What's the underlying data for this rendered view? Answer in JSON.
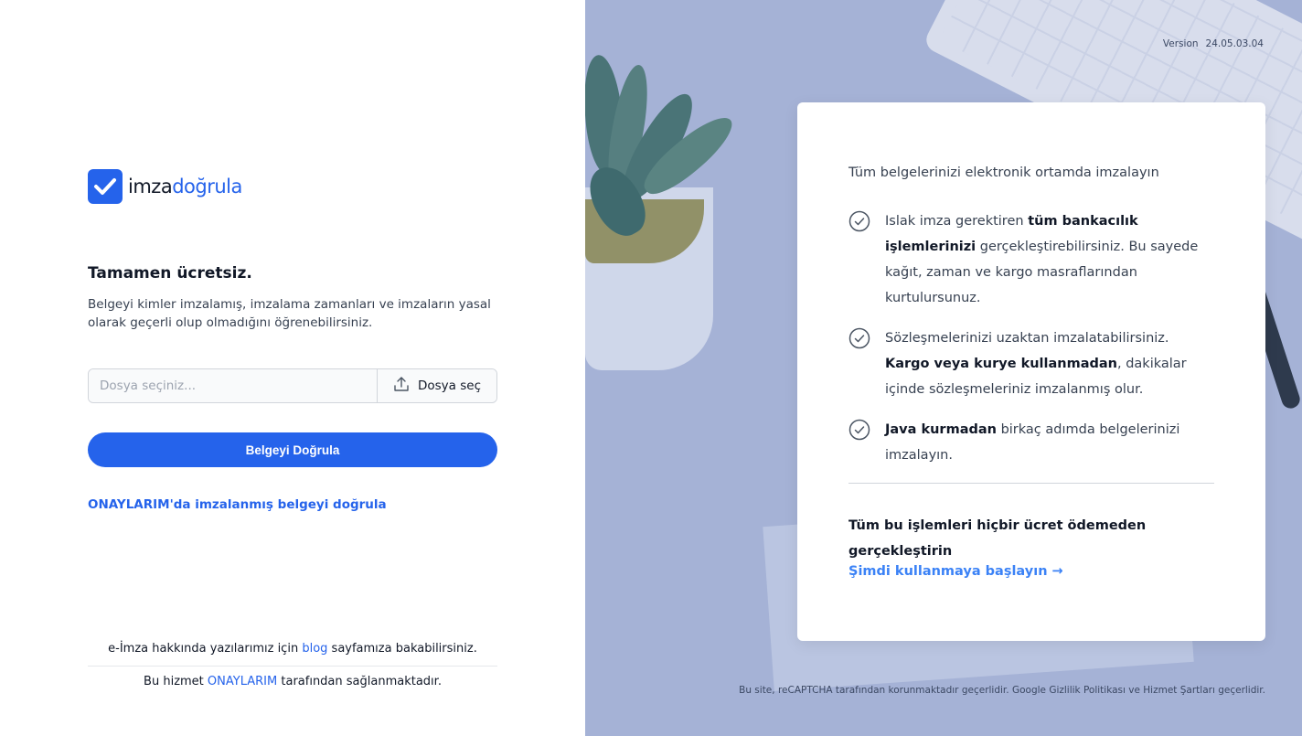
{
  "brand": {
    "name_part1": "imza",
    "name_part2": "doğrula",
    "accent": "#2563eb"
  },
  "left": {
    "title": "Tamamen ücretsiz.",
    "description": "Belgeyi kimler imzalamış, imzalama zamanları ve imzaların yasal olarak geçerli olup olmadığını öğrenebilirsiniz.",
    "file_placeholder": "Dosya seçiniz...",
    "file_button": "Dosya seç",
    "verify_button": "Belgeyi Doğrula",
    "onay_link": "ONAYLARIM'da imzalanmış belgeyi doğrula",
    "footer": {
      "line1_prefix": "e-İmza hakkında yazılarımız için",
      "line1_link": "blog",
      "line1_suffix": "sayfamıza bakabilirsiniz.",
      "line2_prefix": "Bu hizmet",
      "line2_link": "ONAYLARIM",
      "line2_suffix": "tarafından sağlanmaktadır."
    }
  },
  "right": {
    "version_label": "Version",
    "version_value": "24.05.03.04",
    "card": {
      "intro": "Tüm belgelerinizi elektronik ortamda imzalayın",
      "features": [
        {
          "pre": "Islak imza gerektiren ",
          "bold": "tüm bankacılık işlemlerinizi",
          "post": " gerçekleştirebilirsiniz. Bu sayede kağıt, zaman ve kargo masraflarından kurtulursunuz."
        },
        {
          "pre": "Sözleşmelerinizi uzaktan imzalatabilirsiniz. ",
          "bold": "Kargo veya kurye kullanmadan",
          "post": ", dakikalar içinde sözleşmeleriniz imzalanmış olur."
        },
        {
          "pre": "",
          "bold": "Java kurmadan",
          "post": " birkaç adımda belgelerinizi imzalayın."
        }
      ],
      "bottom_text": "Tüm bu işlemleri hiçbir ücret ödemeden gerçekleştirin",
      "cta": "Şimdi kullanmaya başlayın →"
    },
    "recaptcha": "Bu site, reCAPTCHA tarafından korunmaktadır geçerlidir. Google Gizlilik Politikası ve Hizmet Şartları geçerlidir."
  },
  "icons": [
    "check-logo-icon",
    "upload-icon",
    "check-circle-icon"
  ]
}
